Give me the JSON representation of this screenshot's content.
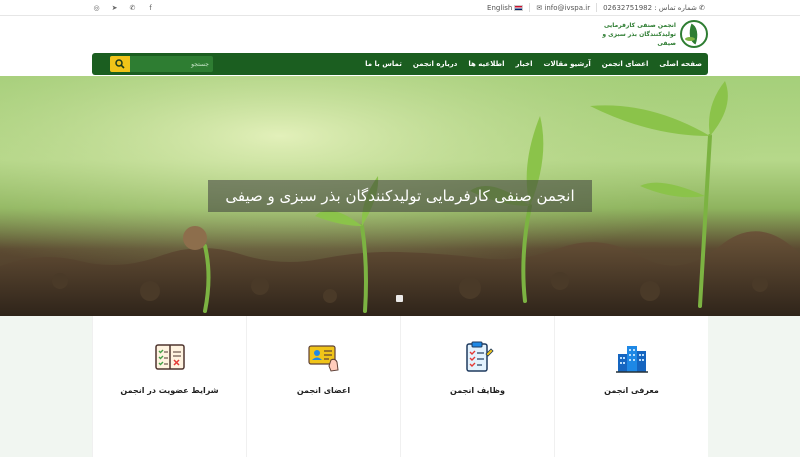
{
  "topbar": {
    "phone_label": "شماره تماس : 02632751982",
    "email": "info@ivspa.ir",
    "language": "English",
    "social": [
      "instagram-icon",
      "telegram-icon",
      "whatsapp-icon",
      "facebook-icon"
    ]
  },
  "logo": {
    "line1": "انجمن صنفی کارفرمایی",
    "line2": "تولیدکنندگان بذر سبزی و صیفی"
  },
  "nav": {
    "items": [
      "صفحه اصلی",
      "اعضای انجمن",
      "آرشیو مقالات",
      "اخبار",
      "اطلاعیه ها",
      "درباره انجمن",
      "تماس با ما"
    ],
    "search_placeholder": "جستجو"
  },
  "hero": {
    "caption": "انجمن صنفی کارفرمایی تولیدکنندگان بذر سبزی و صیفی",
    "slide_index": 1
  },
  "features": [
    {
      "label": "معرفی انجمن",
      "icon": "buildings-icon"
    },
    {
      "label": "وظایف انجمن",
      "icon": "clipboard-check-icon"
    },
    {
      "label": "اعضای انجمن",
      "icon": "member-card-icon"
    },
    {
      "label": "شرایط عضویت در انجمن",
      "icon": "checklist-book-icon"
    }
  ],
  "colors": {
    "nav_bg": "#1b5e20",
    "accent": "#f0c419",
    "brand_green": "#2e7d32"
  }
}
